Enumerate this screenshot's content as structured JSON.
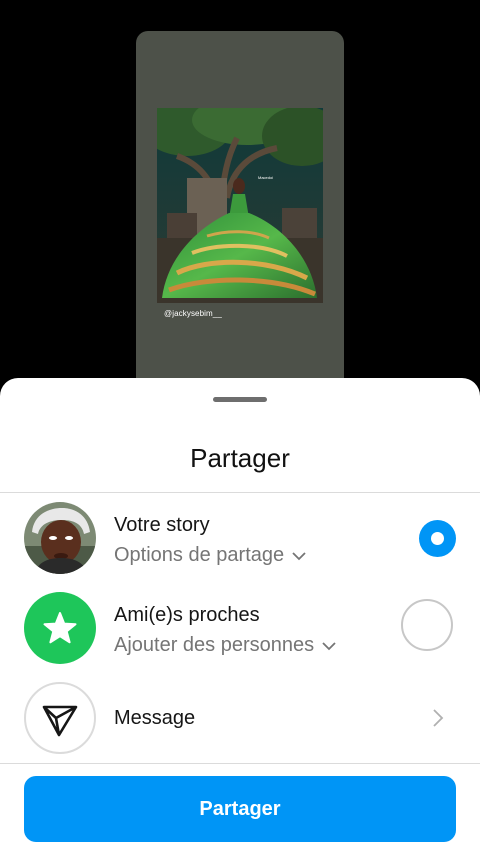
{
  "story_preview": {
    "handle": "@jackysebim__"
  },
  "sheet": {
    "title": "Partager",
    "options": [
      {
        "title": "Votre story",
        "subtitle": "Options de partage",
        "icon": "profile-photo",
        "selected": true
      },
      {
        "title": "Ami(e)s proches",
        "subtitle": "Ajouter des personnes",
        "icon": "star-icon",
        "icon_bg": "#1ec65a",
        "selected": false
      },
      {
        "title": "Message",
        "icon": "paper-plane-icon"
      }
    ],
    "share_button_label": "Partager"
  },
  "colors": {
    "accent": "#0095f6",
    "close_friends_green": "#1ec65a",
    "story_card_bg": "#4d5149"
  }
}
